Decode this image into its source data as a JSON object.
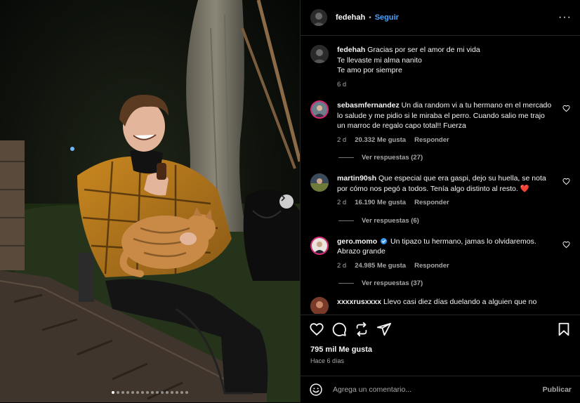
{
  "post": {
    "username": "fedehah",
    "separator": "•",
    "follow_label": "Seguir",
    "more_label": "···",
    "carousel": {
      "total_dots": 16,
      "active_index": 0
    }
  },
  "caption": {
    "username": "fedehah",
    "lines": [
      "Gracias por ser el amor de mi vida",
      "Te llevaste mi alma nanito",
      "Te amo por siempre"
    ],
    "time": "6 d"
  },
  "comments": [
    {
      "username": "sebasmfernandez",
      "text": "Un dia random vi a tu hermano en el mercado lo salude y me pidio si le miraba el perro. Cuando salio me trajo un marroc de regalo capo total!! Fuerza",
      "time": "2 d",
      "likes": "20.332 Me gusta",
      "reply_label": "Responder",
      "view_replies": "Ver respuestas (27)"
    },
    {
      "username": "martin90sh",
      "text": "Que especial que era gaspi, dejo su huella, se nota por cómo nos pegó a todos. Tenía algo distinto al resto. ❤️",
      "time": "2 d",
      "likes": "16.190 Me gusta",
      "reply_label": "Responder",
      "view_replies": "Ver respuestas (6)"
    },
    {
      "username": "gero.momo",
      "verified": true,
      "text": "Un tipazo tu hermano, jamas lo olvidaremos. Abrazo grande",
      "time": "2 d",
      "likes": "24.985 Me gusta",
      "reply_label": "Responder",
      "view_replies": "Ver respuestas (37)"
    },
    {
      "username": "xxxxrusxxxx",
      "text": "Llevo casi diez días duelando a alguien que no"
    }
  ],
  "stats": {
    "likes": "795 mil Me gusta",
    "ago": "Hace 6 días"
  },
  "composer": {
    "placeholder": "Agrega un comentario...",
    "publish_label": "Publicar"
  },
  "colors": {
    "accent": "#4aa3ff",
    "verified": "#3897f0",
    "heart": "#ff3040",
    "muted": "#a8a8a8"
  },
  "icons": [
    "like-icon",
    "comment-icon",
    "share-icon",
    "send-icon",
    "save-icon",
    "emoji-icon",
    "chevron-right-icon"
  ]
}
